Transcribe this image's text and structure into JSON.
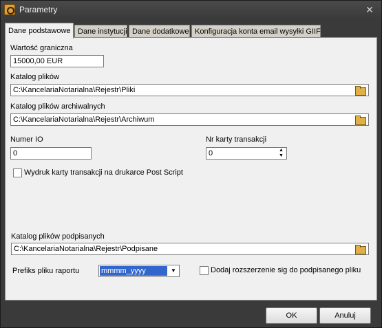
{
  "window": {
    "title": "Parametry",
    "close_glyph": "✕"
  },
  "tabs": [
    {
      "label": "Dane podstawowe",
      "active": true
    },
    {
      "label": "Dane instytucji",
      "active": false
    },
    {
      "label": "Dane dodatkowe",
      "active": false
    },
    {
      "label": "Konfiguracja konta email wysyłki GIIF",
      "active": false
    }
  ],
  "form": {
    "threshold_label": "Wartość graniczna",
    "threshold_value": "15000,00 EUR",
    "files_dir_label": "Katalog plików",
    "files_dir_value": "C:\\KancelariaNotarialna\\Rejestr\\Pliki",
    "archive_dir_label": "Katalog plików archiwalnych",
    "archive_dir_value": "C:\\KancelariaNotarialna\\Rejestr\\Archiwum",
    "io_number_label": "Numer IO",
    "io_number_value": "0",
    "card_number_label": "Nr karty transakcji",
    "card_number_value": "0",
    "postscript_label": "Wydruk karty transakcji na drukarce Post Script",
    "postscript_checked": false,
    "signed_dir_label": "Katalog plików podpisanych",
    "signed_dir_value": "C:\\KancelariaNotarialna\\Rejestr\\Podpisane",
    "report_prefix_label": "Prefiks pliku raportu",
    "report_prefix_value": "mmmm_yyyy",
    "sig_extension_label": "Dodaj rozszerzenie sig do podpisanego pliku",
    "sig_extension_checked": false
  },
  "buttons": {
    "ok_label": "OK",
    "cancel_label": "Anuluj"
  }
}
